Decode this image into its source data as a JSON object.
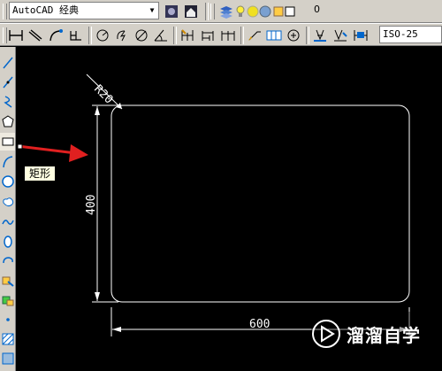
{
  "toolbar": {
    "workspace_value": "AutoCAD 经典",
    "layer_value": "0",
    "dimstyle_value": "ISO-25"
  },
  "tooltip": {
    "text": "矩形"
  },
  "drawing": {
    "dim_radius": "R20",
    "dim_height": "400",
    "dim_width": "600"
  },
  "watermark": {
    "text": "溜溜自学"
  },
  "colors": {
    "accent": "#e02020",
    "line": "#ffffff",
    "background": "#000000"
  }
}
